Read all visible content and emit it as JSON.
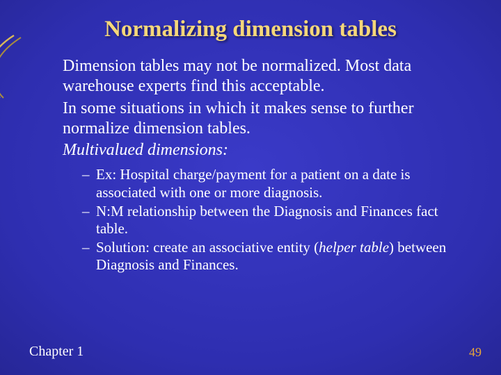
{
  "title": "Normalizing dimension tables",
  "body": {
    "p1": "Dimension tables may not be normalized. Most data warehouse experts find this acceptable.",
    "p2": "In some situations in which it makes sense to further normalize dimension tables.",
    "p3_italic": "Multivalued dimensions:",
    "sub": {
      "i1": "Ex: Hospital charge/payment for a patient on a date is associated with one or more diagnosis.",
      "i2": "N:M relationship between the Diagnosis and Finances fact table.",
      "i3_prefix": "Solution: create an associative entity (",
      "i3_italic": "helper table",
      "i3_suffix": ") between Diagnosis and Finances."
    }
  },
  "footer": {
    "chapter": "Chapter 1",
    "page": "49"
  }
}
